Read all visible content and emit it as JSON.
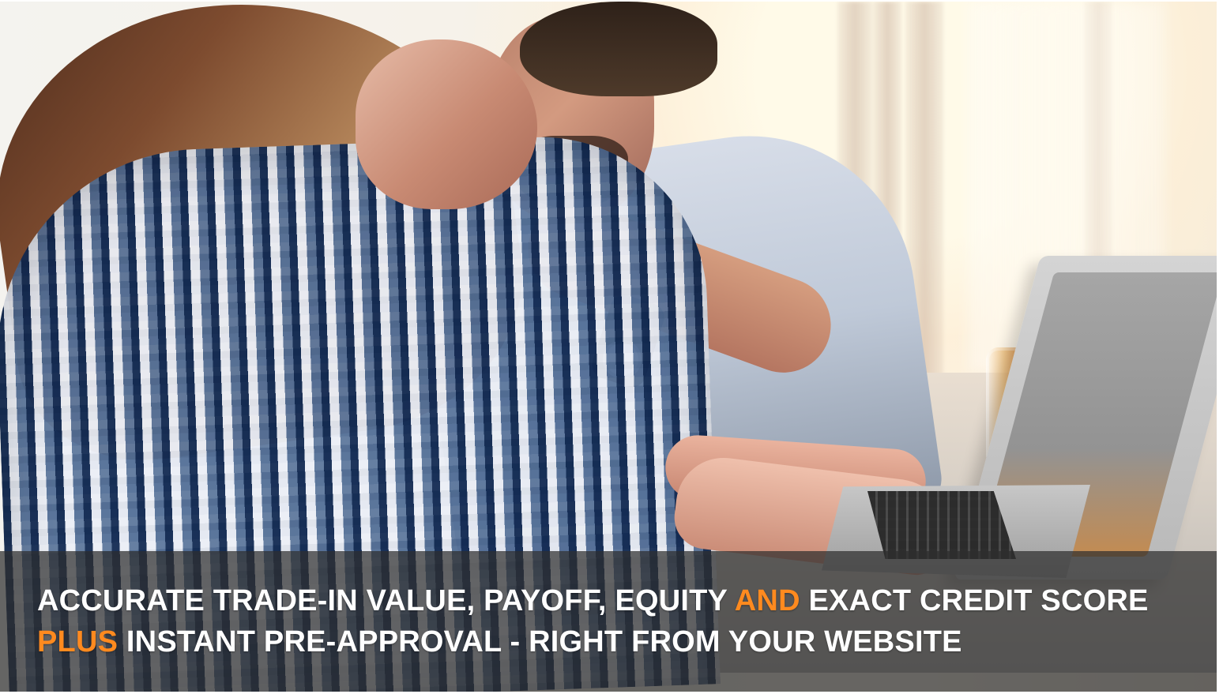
{
  "hero": {
    "line1_part1": "ACCURATE TRADE-IN VALUE, PAYOFF, EQUITY",
    "line1_highlight": "AND",
    "line1_part2": "EXACT CREDIT SCORE",
    "line2_highlight": "PLUS",
    "line2_part": "INSTANT PRE-APPROVAL - RIGHT FROM YOUR WEBSITE"
  },
  "colors": {
    "highlight": "#ff8a1f",
    "text": "#ffffff"
  }
}
